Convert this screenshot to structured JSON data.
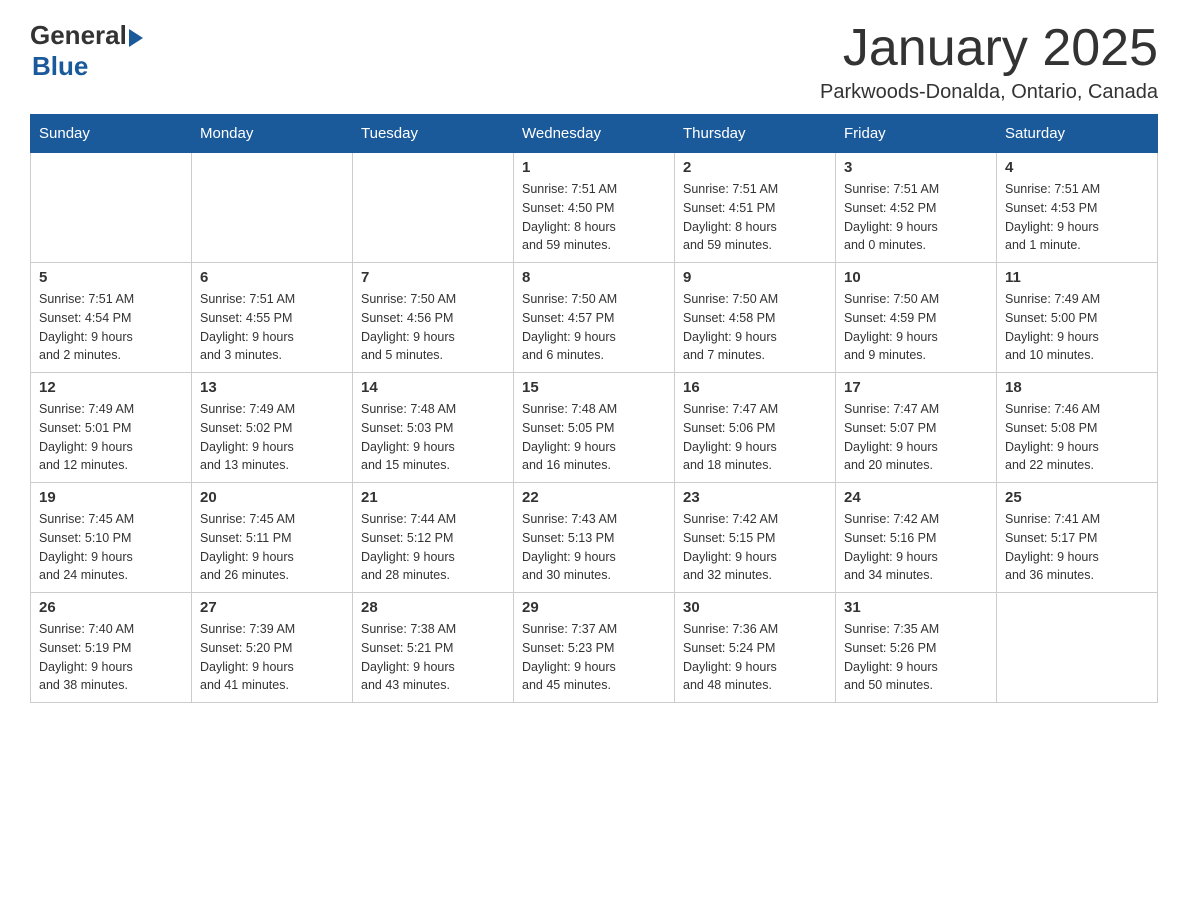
{
  "header": {
    "logo_general": "General",
    "logo_blue": "Blue",
    "title": "January 2025",
    "subtitle": "Parkwoods-Donalda, Ontario, Canada"
  },
  "days_of_week": [
    "Sunday",
    "Monday",
    "Tuesday",
    "Wednesday",
    "Thursday",
    "Friday",
    "Saturday"
  ],
  "weeks": [
    [
      {
        "day": "",
        "info": ""
      },
      {
        "day": "",
        "info": ""
      },
      {
        "day": "",
        "info": ""
      },
      {
        "day": "1",
        "info": "Sunrise: 7:51 AM\nSunset: 4:50 PM\nDaylight: 8 hours\nand 59 minutes."
      },
      {
        "day": "2",
        "info": "Sunrise: 7:51 AM\nSunset: 4:51 PM\nDaylight: 8 hours\nand 59 minutes."
      },
      {
        "day": "3",
        "info": "Sunrise: 7:51 AM\nSunset: 4:52 PM\nDaylight: 9 hours\nand 0 minutes."
      },
      {
        "day": "4",
        "info": "Sunrise: 7:51 AM\nSunset: 4:53 PM\nDaylight: 9 hours\nand 1 minute."
      }
    ],
    [
      {
        "day": "5",
        "info": "Sunrise: 7:51 AM\nSunset: 4:54 PM\nDaylight: 9 hours\nand 2 minutes."
      },
      {
        "day": "6",
        "info": "Sunrise: 7:51 AM\nSunset: 4:55 PM\nDaylight: 9 hours\nand 3 minutes."
      },
      {
        "day": "7",
        "info": "Sunrise: 7:50 AM\nSunset: 4:56 PM\nDaylight: 9 hours\nand 5 minutes."
      },
      {
        "day": "8",
        "info": "Sunrise: 7:50 AM\nSunset: 4:57 PM\nDaylight: 9 hours\nand 6 minutes."
      },
      {
        "day": "9",
        "info": "Sunrise: 7:50 AM\nSunset: 4:58 PM\nDaylight: 9 hours\nand 7 minutes."
      },
      {
        "day": "10",
        "info": "Sunrise: 7:50 AM\nSunset: 4:59 PM\nDaylight: 9 hours\nand 9 minutes."
      },
      {
        "day": "11",
        "info": "Sunrise: 7:49 AM\nSunset: 5:00 PM\nDaylight: 9 hours\nand 10 minutes."
      }
    ],
    [
      {
        "day": "12",
        "info": "Sunrise: 7:49 AM\nSunset: 5:01 PM\nDaylight: 9 hours\nand 12 minutes."
      },
      {
        "day": "13",
        "info": "Sunrise: 7:49 AM\nSunset: 5:02 PM\nDaylight: 9 hours\nand 13 minutes."
      },
      {
        "day": "14",
        "info": "Sunrise: 7:48 AM\nSunset: 5:03 PM\nDaylight: 9 hours\nand 15 minutes."
      },
      {
        "day": "15",
        "info": "Sunrise: 7:48 AM\nSunset: 5:05 PM\nDaylight: 9 hours\nand 16 minutes."
      },
      {
        "day": "16",
        "info": "Sunrise: 7:47 AM\nSunset: 5:06 PM\nDaylight: 9 hours\nand 18 minutes."
      },
      {
        "day": "17",
        "info": "Sunrise: 7:47 AM\nSunset: 5:07 PM\nDaylight: 9 hours\nand 20 minutes."
      },
      {
        "day": "18",
        "info": "Sunrise: 7:46 AM\nSunset: 5:08 PM\nDaylight: 9 hours\nand 22 minutes."
      }
    ],
    [
      {
        "day": "19",
        "info": "Sunrise: 7:45 AM\nSunset: 5:10 PM\nDaylight: 9 hours\nand 24 minutes."
      },
      {
        "day": "20",
        "info": "Sunrise: 7:45 AM\nSunset: 5:11 PM\nDaylight: 9 hours\nand 26 minutes."
      },
      {
        "day": "21",
        "info": "Sunrise: 7:44 AM\nSunset: 5:12 PM\nDaylight: 9 hours\nand 28 minutes."
      },
      {
        "day": "22",
        "info": "Sunrise: 7:43 AM\nSunset: 5:13 PM\nDaylight: 9 hours\nand 30 minutes."
      },
      {
        "day": "23",
        "info": "Sunrise: 7:42 AM\nSunset: 5:15 PM\nDaylight: 9 hours\nand 32 minutes."
      },
      {
        "day": "24",
        "info": "Sunrise: 7:42 AM\nSunset: 5:16 PM\nDaylight: 9 hours\nand 34 minutes."
      },
      {
        "day": "25",
        "info": "Sunrise: 7:41 AM\nSunset: 5:17 PM\nDaylight: 9 hours\nand 36 minutes."
      }
    ],
    [
      {
        "day": "26",
        "info": "Sunrise: 7:40 AM\nSunset: 5:19 PM\nDaylight: 9 hours\nand 38 minutes."
      },
      {
        "day": "27",
        "info": "Sunrise: 7:39 AM\nSunset: 5:20 PM\nDaylight: 9 hours\nand 41 minutes."
      },
      {
        "day": "28",
        "info": "Sunrise: 7:38 AM\nSunset: 5:21 PM\nDaylight: 9 hours\nand 43 minutes."
      },
      {
        "day": "29",
        "info": "Sunrise: 7:37 AM\nSunset: 5:23 PM\nDaylight: 9 hours\nand 45 minutes."
      },
      {
        "day": "30",
        "info": "Sunrise: 7:36 AM\nSunset: 5:24 PM\nDaylight: 9 hours\nand 48 minutes."
      },
      {
        "day": "31",
        "info": "Sunrise: 7:35 AM\nSunset: 5:26 PM\nDaylight: 9 hours\nand 50 minutes."
      },
      {
        "day": "",
        "info": ""
      }
    ]
  ]
}
